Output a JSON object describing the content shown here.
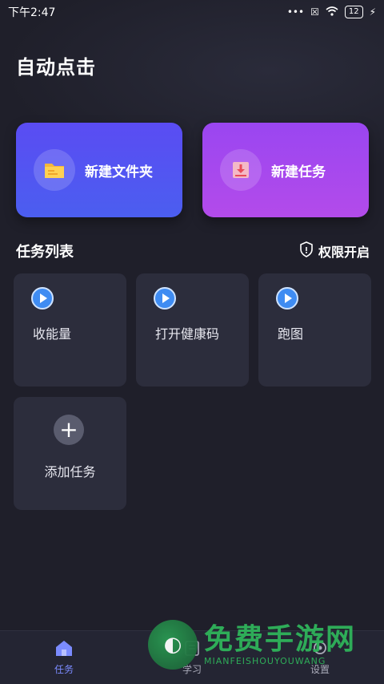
{
  "status_bar": {
    "time": "下午2:47",
    "dots": "•••",
    "battery": "12"
  },
  "app": {
    "title": "自动点击"
  },
  "actions": {
    "new_folder": {
      "label": "新建文件夹",
      "icon": "folder-icon"
    },
    "new_task": {
      "label": "新建任务",
      "icon": "download-icon"
    }
  },
  "section": {
    "title": "任务列表",
    "permission_label": "权限开启"
  },
  "tasks": [
    {
      "name": "收能量",
      "icon": "play-icon"
    },
    {
      "name": "打开健康码",
      "icon": "play-icon"
    },
    {
      "name": "跑图",
      "icon": "play-icon"
    }
  ],
  "add_task": {
    "label": "添加任务",
    "icon": "plus-icon"
  },
  "nav": [
    {
      "label": "任务",
      "icon": "home-icon",
      "active": true
    },
    {
      "label": "学习",
      "icon": "book-icon",
      "active": false
    },
    {
      "label": "设置",
      "icon": "gear-icon",
      "active": false
    }
  ],
  "watermark": {
    "main": "免费手游网",
    "sub": "MIANFEISHOUYOUWANG"
  },
  "colors": {
    "background": "#1f1f2a",
    "accent": "#7b8bff",
    "folder_card": "#5a4cf3",
    "task_card": "#a847ef",
    "tile": "#2c2d3c"
  }
}
